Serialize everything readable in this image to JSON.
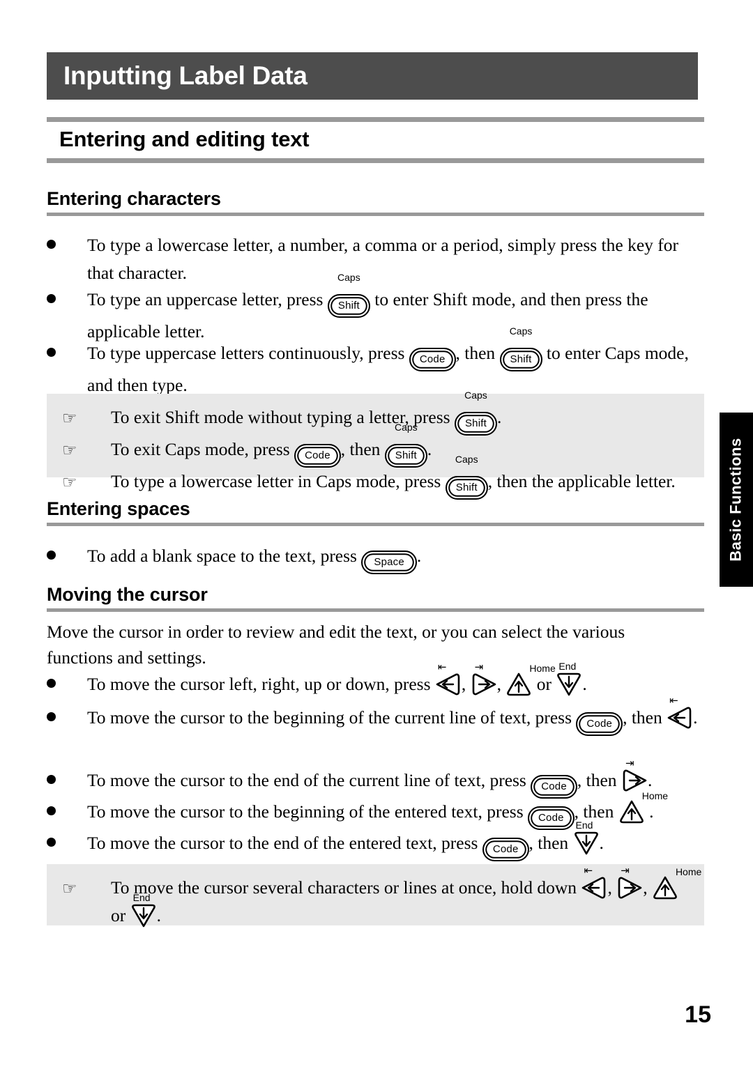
{
  "page": {
    "chapter_title": "Inputting Label Data",
    "folio": "15",
    "thumb_tab": "Basic Functions",
    "colors": {
      "banner": "#4d4d4d",
      "rule": "#999999",
      "note_background": "#e8e8e8",
      "tab_background": "#000000"
    }
  },
  "headings": {
    "h1": "Entering and editing text",
    "entering_characters": "Entering characters",
    "entering_spaces": "Entering spaces",
    "moving_the_cursor": "Moving the cursor"
  },
  "keys": {
    "shift": "Shift",
    "code": "Code",
    "space": "Space",
    "caps_caption": "Caps",
    "home_caption": "Home",
    "end_caption": "End",
    "arrow_left": "left-arrow-key",
    "arrow_right": "right-arrow-key",
    "arrow_up": "up-arrow-key",
    "arrow_down": "down-arrow-key"
  },
  "icons": {
    "bullet": "filled-circle-bullet",
    "note": "pointing-hand-icon"
  },
  "entering_characters": {
    "bullets": [
      {
        "parts": [
          {
            "t": "text",
            "v": "To type a lowercase letter, a number, a comma or a period, simply press the key for that character."
          }
        ]
      },
      {
        "parts": [
          {
            "t": "text",
            "v": "To type an uppercase letter, press "
          },
          {
            "t": "key",
            "v": "shift",
            "cap": "Caps"
          },
          {
            "t": "text",
            "v": " to enter Shift mode, and then press the applicable letter."
          }
        ]
      },
      {
        "parts": [
          {
            "t": "text",
            "v": "To type uppercase letters continuously, press "
          },
          {
            "t": "key",
            "v": "code"
          },
          {
            "t": "text",
            "v": ", then "
          },
          {
            "t": "key",
            "v": "shift",
            "cap": "Caps"
          },
          {
            "t": "text",
            "v": " to enter Caps mode, and then type."
          }
        ]
      }
    ]
  },
  "note_characters": {
    "rows": [
      {
        "parts": [
          {
            "t": "text",
            "v": "To exit Shift mode without typing a letter, press "
          },
          {
            "t": "key",
            "v": "shift",
            "cap": "Caps"
          },
          {
            "t": "text",
            "v": "."
          }
        ]
      },
      {
        "parts": [
          {
            "t": "text",
            "v": "To exit Caps mode, press "
          },
          {
            "t": "key",
            "v": "code"
          },
          {
            "t": "text",
            "v": ", then "
          },
          {
            "t": "key",
            "v": "shift",
            "cap": "Caps"
          },
          {
            "t": "text",
            "v": "."
          }
        ]
      },
      {
        "parts": [
          {
            "t": "text",
            "v": "To type a lowercase letter in Caps mode, press "
          },
          {
            "t": "key",
            "v": "shift",
            "cap": "Caps"
          },
          {
            "t": "text",
            "v": ", then the applicable letter."
          }
        ]
      }
    ]
  },
  "entering_spaces": {
    "bullets": [
      {
        "parts": [
          {
            "t": "text",
            "v": "To add a blank space to the text, press "
          },
          {
            "t": "key",
            "v": "space"
          },
          {
            "t": "text",
            "v": "."
          }
        ]
      }
    ]
  },
  "moving_the_cursor": {
    "intro": "Move the cursor in order to review and edit the text, or you can select the various functions and settings.",
    "bullets": [
      {
        "parts": [
          {
            "t": "text",
            "v": "To move the cursor left, right, up or down, press "
          },
          {
            "t": "arrow",
            "v": "left"
          },
          {
            "t": "text",
            "v": ", "
          },
          {
            "t": "arrow",
            "v": "right"
          },
          {
            "t": "text",
            "v": ", "
          },
          {
            "t": "arrow",
            "v": "up"
          },
          {
            "t": "text",
            "v": "  or "
          },
          {
            "t": "arrow",
            "v": "down"
          },
          {
            "t": "text",
            "v": "."
          }
        ]
      },
      {
        "parts": [
          {
            "t": "text",
            "v": "To move the cursor to the beginning of the current line of text, press "
          },
          {
            "t": "key",
            "v": "code"
          },
          {
            "t": "text",
            "v": ", then "
          },
          {
            "t": "arrow",
            "v": "left"
          },
          {
            "t": "text",
            "v": "."
          }
        ]
      },
      {
        "parts": [
          {
            "t": "text",
            "v": "To move the cursor to the end of the current line of text, press "
          },
          {
            "t": "key",
            "v": "code"
          },
          {
            "t": "text",
            "v": ", then "
          },
          {
            "t": "arrow",
            "v": "right"
          },
          {
            "t": "text",
            "v": "."
          }
        ]
      },
      {
        "parts": [
          {
            "t": "text",
            "v": "To move the cursor to the beginning of the entered text, press "
          },
          {
            "t": "key",
            "v": "code"
          },
          {
            "t": "text",
            "v": ", then "
          },
          {
            "t": "arrow",
            "v": "up"
          },
          {
            "t": "text",
            "v": " ."
          }
        ]
      },
      {
        "parts": [
          {
            "t": "text",
            "v": "To move the cursor to the end of the entered text, press "
          },
          {
            "t": "key",
            "v": "code"
          },
          {
            "t": "text",
            "v": ", then "
          },
          {
            "t": "arrow",
            "v": "down"
          },
          {
            "t": "text",
            "v": "."
          }
        ]
      }
    ]
  },
  "note_cursor": {
    "rows": [
      {
        "parts": [
          {
            "t": "text",
            "v": "To move the cursor several characters or lines at once, hold down "
          },
          {
            "t": "arrow",
            "v": "left"
          },
          {
            "t": "text",
            "v": ", "
          },
          {
            "t": "arrow",
            "v": "right"
          },
          {
            "t": "text",
            "v": ", "
          },
          {
            "t": "arrow",
            "v": "up"
          },
          {
            "t": "text",
            "v": "  or "
          },
          {
            "t": "arrow",
            "v": "down"
          },
          {
            "t": "text",
            "v": "."
          }
        ]
      }
    ]
  }
}
